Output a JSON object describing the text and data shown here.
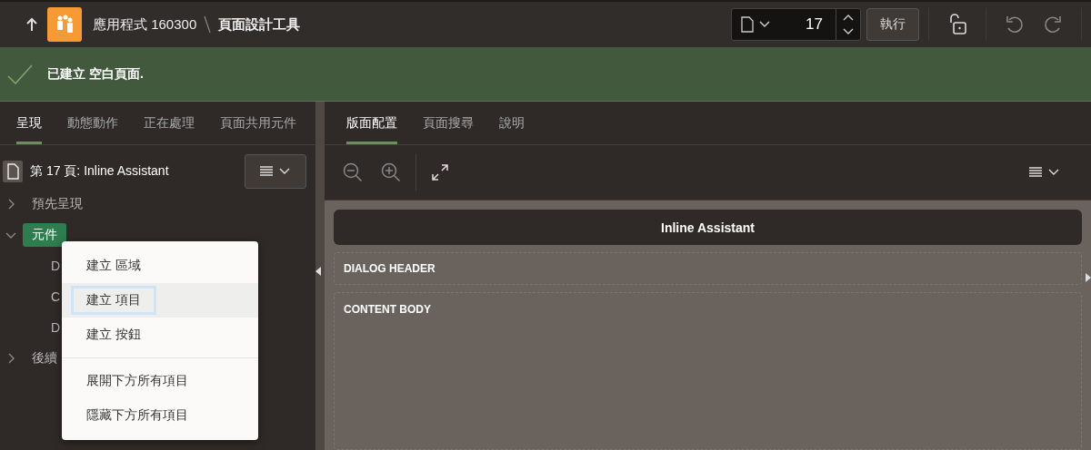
{
  "top_bar": {
    "app_name": "應用程式 160300",
    "page_title": "頁面設計工具",
    "page_number": "17",
    "run_button": "執行"
  },
  "message": {
    "text": "已建立 空白頁面."
  },
  "left_tabs": [
    {
      "label": "呈現",
      "selected": true
    },
    {
      "label": "動態動作",
      "selected": false
    },
    {
      "label": "正在處理",
      "selected": false
    },
    {
      "label": "頁面共用元件",
      "selected": false
    }
  ],
  "tree": {
    "title": "第 17 頁: Inline Assistant",
    "items": [
      {
        "label": "預先呈現",
        "expanded": false,
        "selected": false
      },
      {
        "label": "元件",
        "expanded": true,
        "selected": true,
        "children": [
          {
            "label": "D"
          },
          {
            "label": "C"
          },
          {
            "label": "D"
          }
        ]
      },
      {
        "label": "後續",
        "expanded": false,
        "selected": false
      }
    ]
  },
  "context_menu": {
    "groups": [
      [
        {
          "label": "建立 區域",
          "selected": false
        },
        {
          "label": "建立 項目",
          "selected": true
        },
        {
          "label": "建立 按鈕",
          "selected": false
        }
      ],
      [
        {
          "label": "展開下方所有項目",
          "selected": false
        },
        {
          "label": "隱藏下方所有項目",
          "selected": false
        }
      ]
    ]
  },
  "right_tabs": [
    {
      "label": "版面配置",
      "selected": true
    },
    {
      "label": "頁面搜尋",
      "selected": false
    },
    {
      "label": "說明",
      "selected": false
    }
  ],
  "layout": {
    "region_title": "Inline Assistant",
    "sections": [
      "DIALOG HEADER",
      "CONTENT BODY"
    ]
  }
}
